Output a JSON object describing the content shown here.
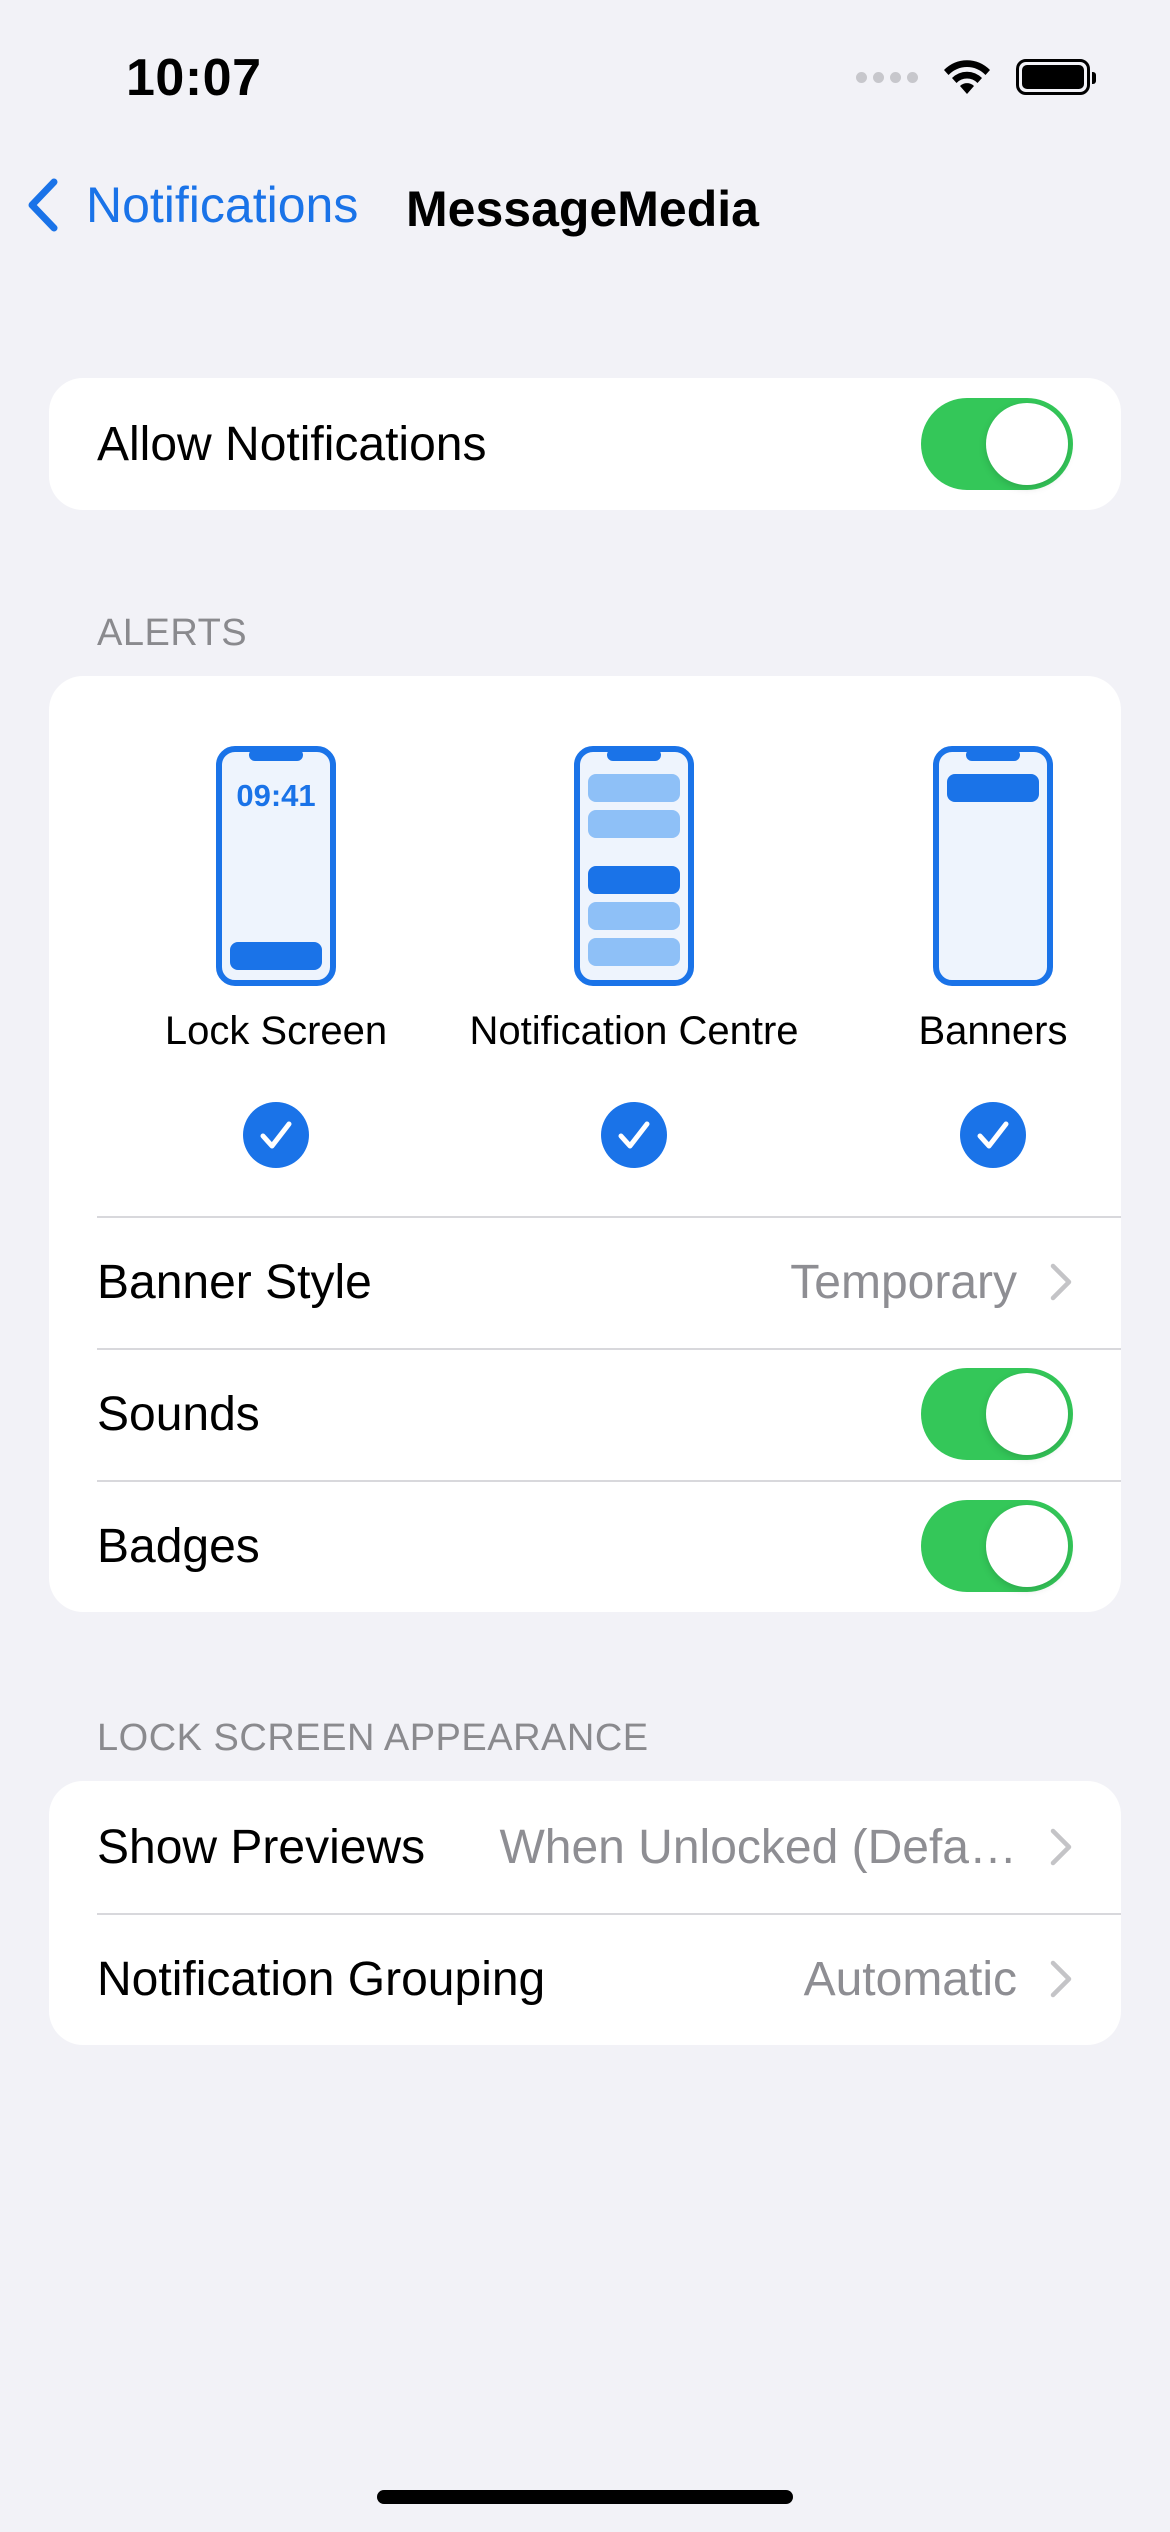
{
  "status_bar": {
    "time": "10:07"
  },
  "nav": {
    "back_label": "Notifications",
    "title": "MessageMedia"
  },
  "allow": {
    "label": "Allow Notifications",
    "enabled": true
  },
  "alerts": {
    "header": "ALERTS",
    "options": [
      {
        "label": "Lock Screen",
        "preview_time": "09:41",
        "checked": true
      },
      {
        "label": "Notification Centre",
        "checked": true
      },
      {
        "label": "Banners",
        "checked": true
      }
    ],
    "banner_style": {
      "label": "Banner Style",
      "value": "Temporary"
    },
    "sounds": {
      "label": "Sounds",
      "enabled": true
    },
    "badges": {
      "label": "Badges",
      "enabled": true
    }
  },
  "lock_screen": {
    "header": "LOCK SCREEN APPEARANCE",
    "show_previews": {
      "label": "Show Previews",
      "value": "When Unlocked (Defa…"
    },
    "grouping": {
      "label": "Notification Grouping",
      "value": "Automatic"
    }
  },
  "colors": {
    "accent": "#1a73e8",
    "toggle_on": "#34c759",
    "background": "#f2f2f7",
    "secondary_text": "#8e8e93"
  },
  "icons": [
    "chevron-left-icon",
    "wifi-icon",
    "battery-icon",
    "checkmark-circle-icon",
    "chevron-right-icon"
  ]
}
